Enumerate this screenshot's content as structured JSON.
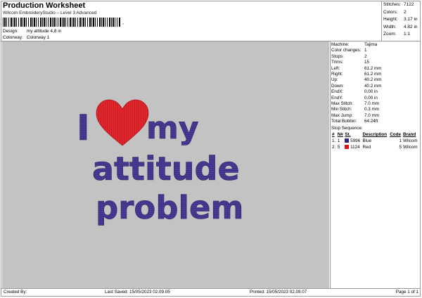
{
  "header": {
    "title": "Production Worksheet",
    "subtitle": "Wilcom EmbroideryStudio – Level 3 Advanced",
    "barcode_mark": ",",
    "design_label": "Design:",
    "design_value": "my attitude 4,8 in",
    "colorway_label": "Colorway:",
    "colorway_value": "Colorway 1"
  },
  "summary": [
    {
      "label": "Stitches:",
      "value": "7122"
    },
    {
      "label": "Colors:",
      "value": "2"
    },
    {
      "label": "Height:",
      "value": "3.17 in"
    },
    {
      "label": "Width:",
      "value": "4.82 in"
    },
    {
      "label": "Zoom:",
      "value": "1:1"
    }
  ],
  "design": {
    "line1": "my",
    "line2": "attitude",
    "line3": "problem",
    "letter_i": "I",
    "text_color": "#4a3a94",
    "heart_color": "#e0282e",
    "background": "#c3c3c3"
  },
  "machine_info": [
    {
      "label": "Machine:",
      "value": "Tajima"
    },
    {
      "label": "Color changes:",
      "value": "1"
    },
    {
      "label": "Stops:",
      "value": "2"
    },
    {
      "label": "Trims:",
      "value": "15"
    },
    {
      "label": "Left:",
      "value": "61.2 mm"
    },
    {
      "label": "Right:",
      "value": "61.2 mm"
    },
    {
      "label": "Up:",
      "value": "40.2 mm"
    },
    {
      "label": "Down:",
      "value": "40.2 mm"
    },
    {
      "label": "EndX:",
      "value": "0.00 in"
    },
    {
      "label": "EndY:",
      "value": "0.00 in"
    },
    {
      "label": "Max Stitch:",
      "value": "7.0 mm"
    },
    {
      "label": "Min Stitch:",
      "value": "0.3 mm"
    },
    {
      "label": "Max Jump:",
      "value": "7.0 mm"
    },
    {
      "label": "Total Bobbin:",
      "value": "64.24ft"
    }
  ],
  "stop_sequence": {
    "title": "Stop Sequence:",
    "headers": [
      "#",
      "N#",
      "St.",
      "Description",
      "Code",
      "Brand"
    ],
    "rows": [
      {
        "num": "1.",
        "n": "1",
        "st": "5996",
        "desc": "Blue",
        "code": "1",
        "brand": "Wilcom",
        "color": "#2b2a7a"
      },
      {
        "num": "2.",
        "n": "5",
        "st": "1124",
        "desc": "Red",
        "code": "5",
        "brand": "Wilcom",
        "color": "#d8141c"
      }
    ]
  },
  "footer": {
    "created_by": "Created By:",
    "last_saved": "Last Saved: 15/05/2023 02.09.05",
    "printed": "Printed: 15/05/2023 02.09.07",
    "page": "Page 1 of 1"
  }
}
